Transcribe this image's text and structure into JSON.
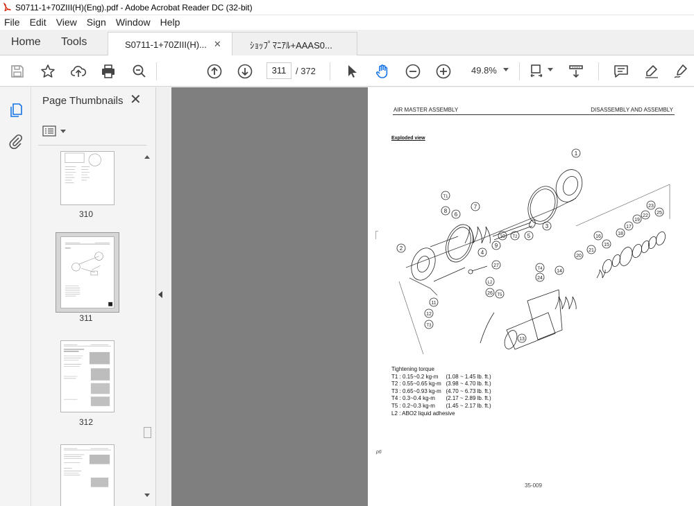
{
  "window": {
    "title": "S0711-1+70ZIII(H)(Eng).pdf - Adobe Acrobat Reader DC (32-bit)"
  },
  "menu": [
    "File",
    "Edit",
    "View",
    "Sign",
    "Window",
    "Help"
  ],
  "tabs": {
    "home": "Home",
    "tools": "Tools",
    "active_doc": "S0711-1+70ZIII(H)...",
    "inactive_doc": "ｼｮｯﾌﾟﾏﾆｱﾙ+AAAS0..."
  },
  "toolbar": {
    "current_page": "311",
    "total_pages": "/  372",
    "zoom": "49.8%"
  },
  "thumbnails_panel": {
    "title": "Page Thumbnails",
    "pages": [
      {
        "label": "310"
      },
      {
        "label": "311"
      },
      {
        "label": "312"
      },
      {
        "label": ""
      }
    ]
  },
  "page": {
    "header_left": "AIR MASTER ASSEMBLY",
    "header_right": "DISASSEMBLY AND ASSEMBLY",
    "section_title": "Exploded view",
    "torque_title": "Tightening torque",
    "torque_rows": [
      "T1 : 0.15~0.2 kg-m     (1.08 ~ 1.45 lb. ft.)",
      "T2 : 0.55~0.65 kg-m   (3.98 ~ 4.70 lb. ft.)",
      "T3 : 0.65~0.93 kg-m   (4.70 ~ 6.73 lb. ft.)",
      "T4 : 0.3~0.4 kg-m       (2.17 ~ 2.89 lb. ft.)",
      "T5 : 0.2~0.3 kg-m       (1.45 ~ 2.17 lb. ft.)",
      "L2 : ABO2 liquid adhesive"
    ],
    "margin_mark": "p6",
    "page_number": "35-009",
    "callouts": [
      "1",
      "2",
      "3",
      "4",
      "5",
      "6",
      "7",
      "8",
      "9",
      "10",
      "11",
      "12",
      "13",
      "14",
      "15",
      "16",
      "17",
      "18",
      "19",
      "20",
      "21",
      "22",
      "23",
      "24",
      "25",
      "26",
      "27",
      "T1",
      "T2",
      "T3",
      "T4",
      "T5",
      "L2"
    ]
  },
  "colors": {
    "accent": "#1473e6",
    "doc_background": "#7f7f7f",
    "pdf_red": "#d81e05"
  }
}
